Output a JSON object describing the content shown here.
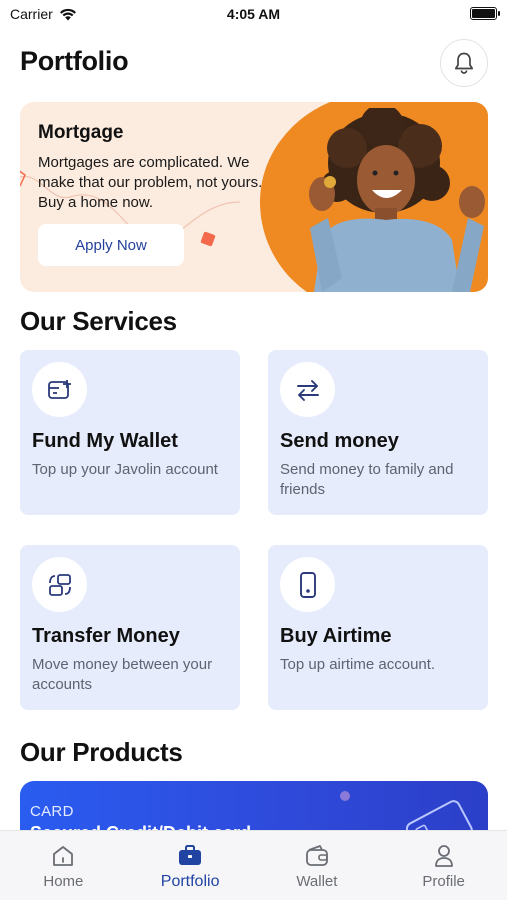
{
  "status_bar": {
    "carrier": "Carrier",
    "time": "4:05 AM"
  },
  "header": {
    "title": "Portfolio"
  },
  "promo": {
    "title": "Mortgage",
    "text": "Mortgages are complicated. We make that our problem, not yours. Buy a home now.",
    "button_label": "Apply Now"
  },
  "services": {
    "title": "Our Services",
    "items": [
      {
        "title": "Fund My Wallet",
        "description": "Top up your Javolin account",
        "icon": "wallet-card-icon"
      },
      {
        "title": "Send money",
        "description": "Send money to family and friends",
        "icon": "transfer-arrows-icon"
      },
      {
        "title": "Transfer Money",
        "description": "Move money between your accounts",
        "icon": "cards-exchange-icon"
      },
      {
        "title": "Buy Airtime",
        "description": "Top up airtime account.",
        "icon": "phone-icon"
      }
    ]
  },
  "products": {
    "title": "Our Products",
    "card": {
      "label": "CARD",
      "name": "Secured Credit/Debit card"
    }
  },
  "tabs": [
    {
      "label": "Home",
      "icon": "home-icon",
      "active": false
    },
    {
      "label": "Portfolio",
      "icon": "briefcase-icon",
      "active": true
    },
    {
      "label": "Wallet",
      "icon": "wallet-icon",
      "active": false
    },
    {
      "label": "Profile",
      "icon": "person-icon",
      "active": false
    }
  ],
  "colors": {
    "accent": "#2144a3",
    "promo_orange": "#ef8a22",
    "service_card_bg": "#e6ecfb",
    "product_card_blue": "#2f49d9"
  }
}
